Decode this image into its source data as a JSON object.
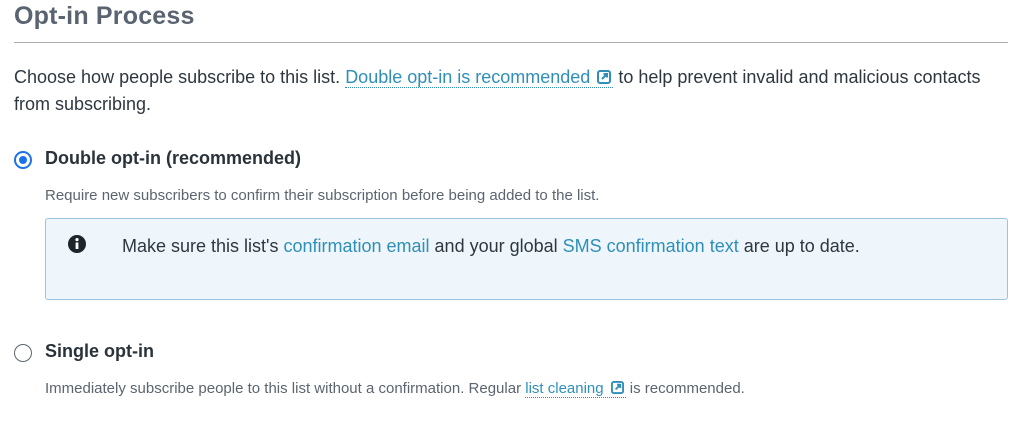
{
  "section": {
    "title": "Opt-in Process"
  },
  "intro": {
    "text_before": "Choose how people subscribe to this list. ",
    "link_label": "Double opt-in is recommended",
    "link_icon": "external-link-icon",
    "text_after": " to help prevent invalid and malicious contacts from subscribing."
  },
  "options": [
    {
      "label": "Double opt-in (recommended)",
      "selected": true,
      "description": "Require new subscribers to confirm their subscription before being added to the list.",
      "notice": {
        "icon": "info-icon",
        "text_1": "Make sure this list's ",
        "link_1": "confirmation email",
        "text_2": " and your global ",
        "link_2": "SMS confirmation text",
        "text_3": " are up to date."
      }
    },
    {
      "label": "Single opt-in",
      "selected": false,
      "description_before": "Immediately subscribe people to this list without a confirmation. Regular ",
      "description_link": "list cleaning",
      "description_link_icon": "external-link-icon",
      "description_after": " is recommended."
    }
  ],
  "colors": {
    "link": "#2f8fb8",
    "radio_selected": "#1a73e8",
    "notice_background": "#eef6fb",
    "notice_border": "#9cc4dc",
    "title": "#5a6470"
  }
}
